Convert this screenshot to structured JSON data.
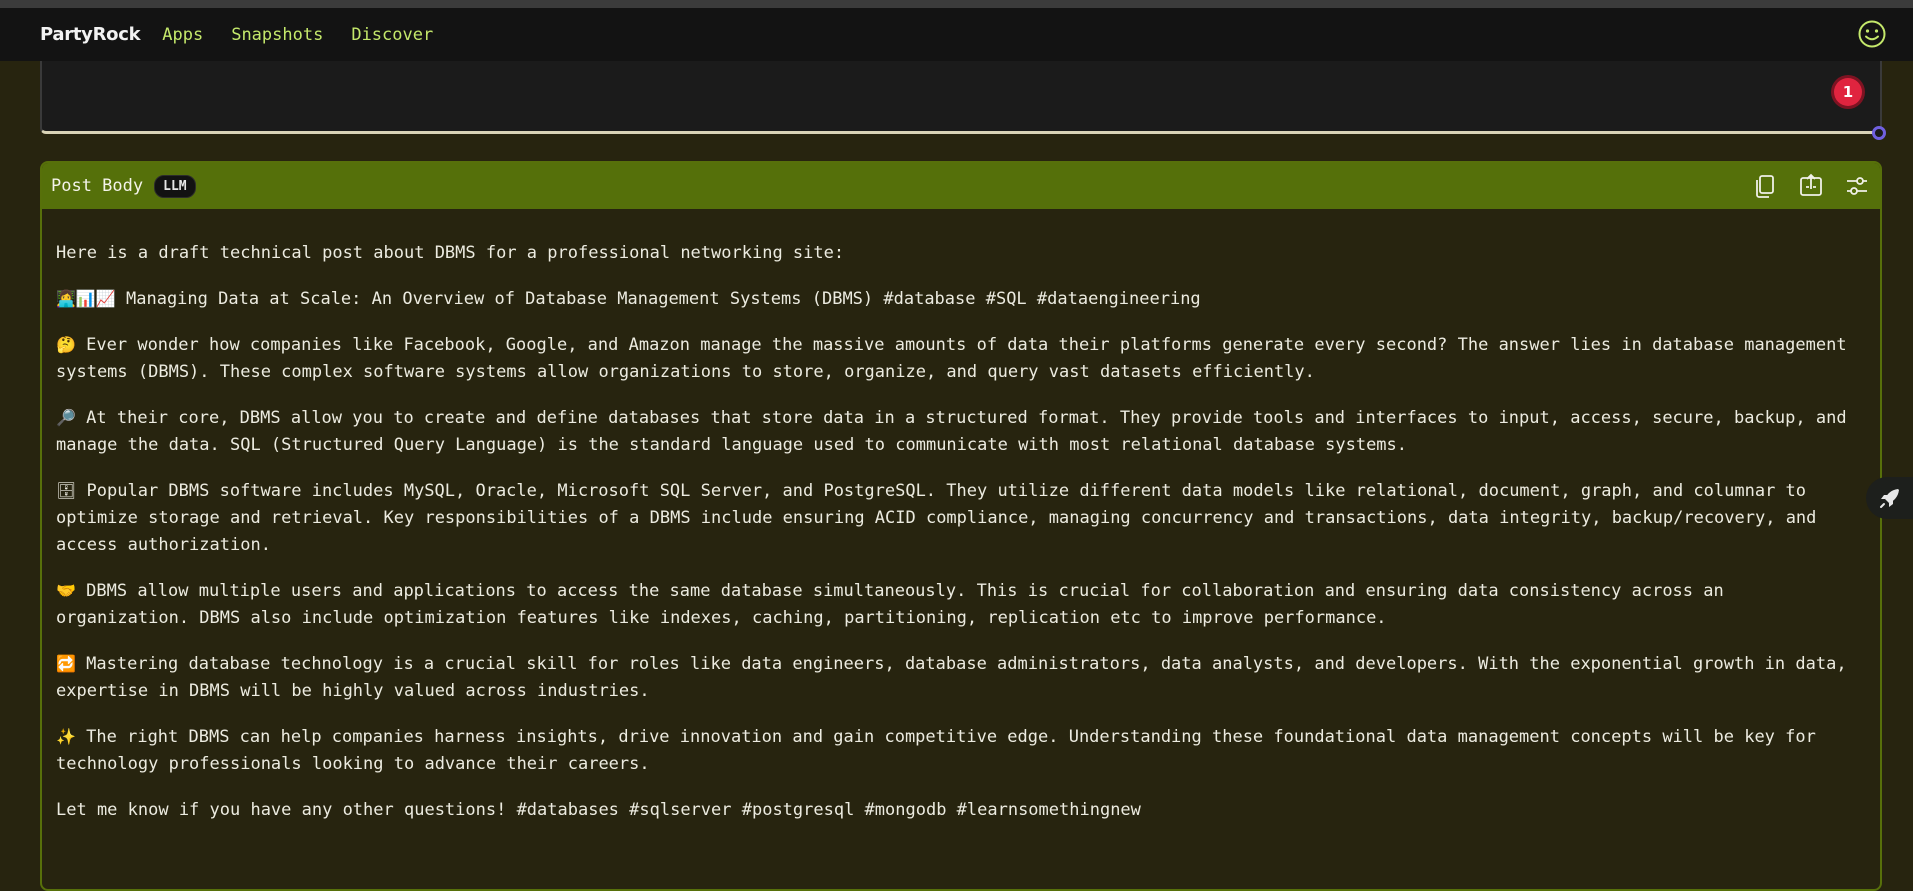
{
  "navbar": {
    "brand": "PartyRock",
    "links": [
      "Apps",
      "Snapshots",
      "Discover"
    ]
  },
  "previous_widget": {
    "notification_count": "1"
  },
  "widget": {
    "title": "Post Body",
    "tag": "LLM",
    "actions": [
      "copy-icon",
      "export-icon",
      "settings-sliders-icon"
    ],
    "paragraphs": [
      {
        "emoji": "",
        "text": "Here is a draft technical post about DBMS for a professional networking site:"
      },
      {
        "emoji": "👩‍💻📊📈",
        "text": " Managing Data at Scale: An Overview of Database Management Systems (DBMS) #database #SQL #dataengineering"
      },
      {
        "emoji": "🤔",
        "text": " Ever wonder how companies like Facebook, Google, and Amazon manage the massive amounts of data their platforms generate every second? The answer lies in database management systems (DBMS). These complex software systems allow organizations to store, organize, and query vast datasets efficiently."
      },
      {
        "emoji": "🔎",
        "text": " At their core, DBMS allow you to create and define databases that store data in a structured format. They provide tools and interfaces to input, access, secure, backup, and manage the data. SQL (Structured Query Language) is the standard language used to communicate with most relational database systems."
      },
      {
        "emoji": "🗄",
        "text": " Popular DBMS software includes MySQL, Oracle, Microsoft SQL Server, and PostgreSQL. They utilize different data models like relational, document, graph, and columnar to optimize storage and retrieval. Key responsibilities of a DBMS include ensuring ACID compliance, managing concurrency and transactions, data integrity, backup/recovery, and access authorization."
      },
      {
        "emoji": "🤝",
        "text": " DBMS allow multiple users and applications to access the same database simultaneously. This is crucial for collaboration and ensuring data consistency across an organization. DBMS also include optimization features like indexes, caching, partitioning, replication etc to improve performance."
      },
      {
        "emoji": "🔁",
        "text": " Mastering database technology is a crucial skill for roles like data engineers, database administrators, data analysts, and developers. With the exponential growth in data, expertise in DBMS will be highly valued across industries."
      },
      {
        "emoji": "✨",
        "text": " The right DBMS can help companies harness insights, drive innovation and gain competitive edge. Understanding these foundational data management concepts will be key for technology professionals looking to advance their careers."
      },
      {
        "emoji": "",
        "text": "Let me know if you have any other questions! #databases #sqlserver #postgresql #mongodb #learnsomethingnew"
      }
    ]
  },
  "colors": {
    "accent_green": "#c4e86b",
    "header_olive": "#55700a",
    "badge_red": "#e0243f"
  }
}
